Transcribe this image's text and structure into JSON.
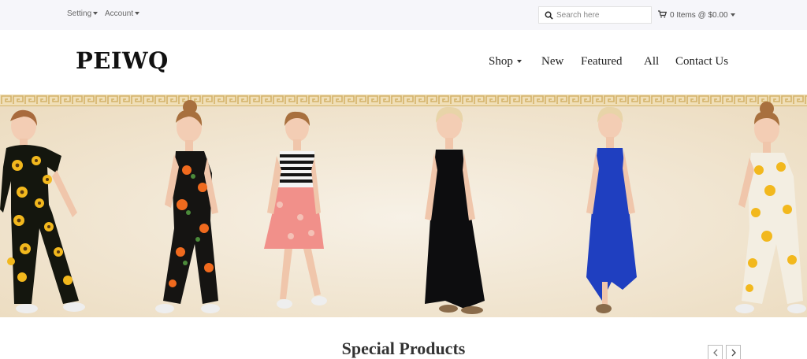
{
  "topbar": {
    "setting_label": "Setting",
    "account_label": "Account",
    "search_placeholder": "Search here",
    "cart_label": "0 Items @ $0.00"
  },
  "header": {
    "logo": "PEIWQ",
    "nav": [
      "Shop",
      "New",
      "Featured",
      "All",
      "Contact Us"
    ]
  },
  "banner": {
    "description_icon": "banner-image"
  },
  "special": {
    "title": "Special Products"
  },
  "icons": {
    "search": "search-icon",
    "cart": "cart-icon",
    "prev": "chevron-left-icon",
    "next": "chevron-right-icon"
  },
  "colors": {
    "topbar_bg": "#f6f6fa",
    "banner_bg": "#f1e7d6",
    "banner_border": "#d8b86a"
  }
}
